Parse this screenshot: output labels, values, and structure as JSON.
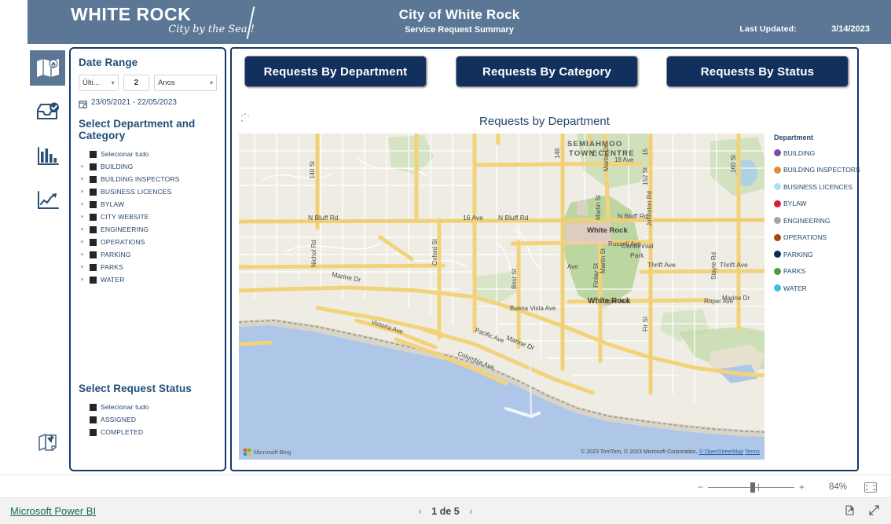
{
  "header": {
    "logo_main": "WHITE ROCK",
    "logo_sub": "City by the Sea !",
    "title": "City of White Rock",
    "subtitle": "Service Request Summary",
    "updated_label": "Last Updated:",
    "updated_value": "3/14/2023",
    "bg_color": "#5b7795"
  },
  "rail": {
    "items": [
      {
        "name": "map-icon",
        "active": true
      },
      {
        "name": "inbox-check-icon",
        "active": false
      },
      {
        "name": "bar-chart-icon",
        "active": false
      },
      {
        "name": "line-chart-icon",
        "active": false
      },
      {
        "name": "pinned-notes-icon",
        "active": false
      }
    ]
  },
  "filters": {
    "date_range_heading": "Date Range",
    "relative_mode": "Últi...",
    "relative_count": "2",
    "relative_unit": "Anos",
    "date_range_text": "23/05/2021 - 22/05/2023",
    "department_heading": "Select Department and Category",
    "select_all_label": "Selecionar tudo",
    "departments": [
      "BUILDING",
      "BUILDING INSPECTORS",
      "BUSINESS LICENCES",
      "BYLAW",
      "CITY WEBSITE",
      "ENGINEERING",
      "OPERATIONS",
      "PARKING",
      "PARKS",
      "WATER"
    ],
    "status_heading": "Select Request Status",
    "status_select_all_label": "Selecionar tudo",
    "statuses": [
      "ASSIGNED",
      "COMPLETED"
    ]
  },
  "report": {
    "buttons": [
      "Requests By Department",
      "Requests By Category",
      "Requests By Status"
    ],
    "chart_title": "Requests by Department",
    "legend_title": "Department",
    "legend": [
      {
        "label": "BUILDING",
        "color": "#7b4ea8"
      },
      {
        "label": "BUILDING INSPECTORS",
        "color": "#e08b3c"
      },
      {
        "label": "BUSINESS LICENCES",
        "color": "#a5e3f5"
      },
      {
        "label": "BYLAW",
        "color": "#d31c3e"
      },
      {
        "label": "ENGINEERING",
        "color": "#a6a6a6"
      },
      {
        "label": "OPERATIONS",
        "color": "#9e4a13"
      },
      {
        "label": "PARKING",
        "color": "#0d2b59"
      },
      {
        "label": "PARKS",
        "color": "#4e9c43"
      },
      {
        "label": "WATER",
        "color": "#39c0de"
      }
    ],
    "map": {
      "provider_label": "Microsoft Bing",
      "attribution": "© 2023 TomTom, © 2023 Microsoft Corporation,",
      "attribution_link": "© OpenStreetMap",
      "attribution_terms": "Terms",
      "place_labels": [
        "SEMIAHMOO",
        "TOWN CENTRE",
        "White Rock",
        "Centennial",
        "Park"
      ],
      "street_labels": [
        "N Bluff Rd",
        "16 Ave",
        "N Bluff Rd",
        "18 Ave",
        "Nichol Rd",
        "140 St",
        "148",
        "152 St",
        "160 St",
        "15",
        "15",
        "Martin Dr",
        "Martin St",
        "Johnston Rd",
        "Best St",
        "Finlay St",
        "Oxford St",
        "Fir St",
        "Stayte Rd",
        "Marine Dr",
        "Marine Dr",
        "Marine Dr",
        "Russell Ave",
        "Thrift Ave",
        "Thrift Ave",
        "Roper Ave",
        "Roper Ave",
        "Buena Vista Ave",
        "Victoria Ave",
        "Pacific Ave",
        "Columbia Ave"
      ]
    }
  },
  "statusbar": {
    "zoom_minus": "−",
    "zoom_plus": "+",
    "zoom_percent": "84%"
  },
  "footer": {
    "brand_link": "Microsoft Power BI",
    "prev_arrow": "‹",
    "page_text": "1 de 5",
    "next_arrow": "›"
  }
}
